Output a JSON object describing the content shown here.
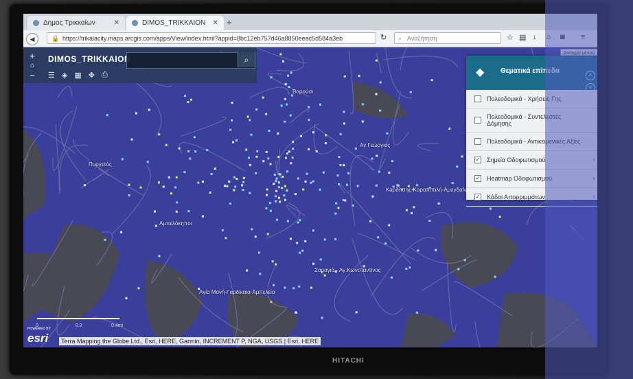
{
  "browser": {
    "tabs": [
      {
        "label": "Δημος Τρικκαίων",
        "active": false
      },
      {
        "label": "DIMOS_TRIKKAION",
        "active": true
      }
    ],
    "new_tab": "+",
    "url": "https://trikalacity.maps.arcgis.com/apps/View/index.html?appid=8bc12eb757d46a8850eeac5d584a3eb",
    "search_placeholder": "Αναζήτηση"
  },
  "app": {
    "title": "DIMOS_TRIKKAION",
    "zoom_in": "+",
    "zoom_out": "−"
  },
  "layers_panel": {
    "title": "Θεματικά επίπεδα",
    "close_label": "Άνοιγμα μενού",
    "layers": [
      {
        "label": "Πολεοδομικά - Χρήσεις Γης",
        "checked": false
      },
      {
        "label": "Πολεοδομικά - Συντελεστές Δόμησης",
        "checked": false
      },
      {
        "label": "Πολεοδομικά - Αντικειμενικές Αξίες",
        "checked": false
      },
      {
        "label": "Σημεία Οδοφωτισμού",
        "checked": true
      },
      {
        "label": "Heatmap Οδοφωτισμού",
        "checked": true
      },
      {
        "label": "Κάδοι Απορριμμάτων",
        "checked": true
      }
    ]
  },
  "map": {
    "places": [
      "Πυργετός",
      "Αμπελόκηποι",
      "Αγία Μονή-Γαρδίκαια-Αμπελεία",
      "Σαραγιά - Αγ.Κωνσταντίνος",
      "Βαρούσι",
      "Καρδίτσης-Καραπιπιλή-Αμυγδαλιές",
      "Αγ.Γεώργιος"
    ],
    "attribution": "Terra Mapping the Globe Ltd., Esri, HERE, Garmin, INCREMENT P, NGA, USGS | Esri, HERE",
    "powered_by": "POWERED BY",
    "esri": "esri",
    "scale_labels": [
      "0",
      "0.2",
      "0.4mi"
    ]
  },
  "tv": {
    "brand": "HITACHI"
  },
  "colors": {
    "heatmap": "#3b3f9c",
    "panel_header": "#1b6b8a",
    "road": "#7a7aa8"
  }
}
